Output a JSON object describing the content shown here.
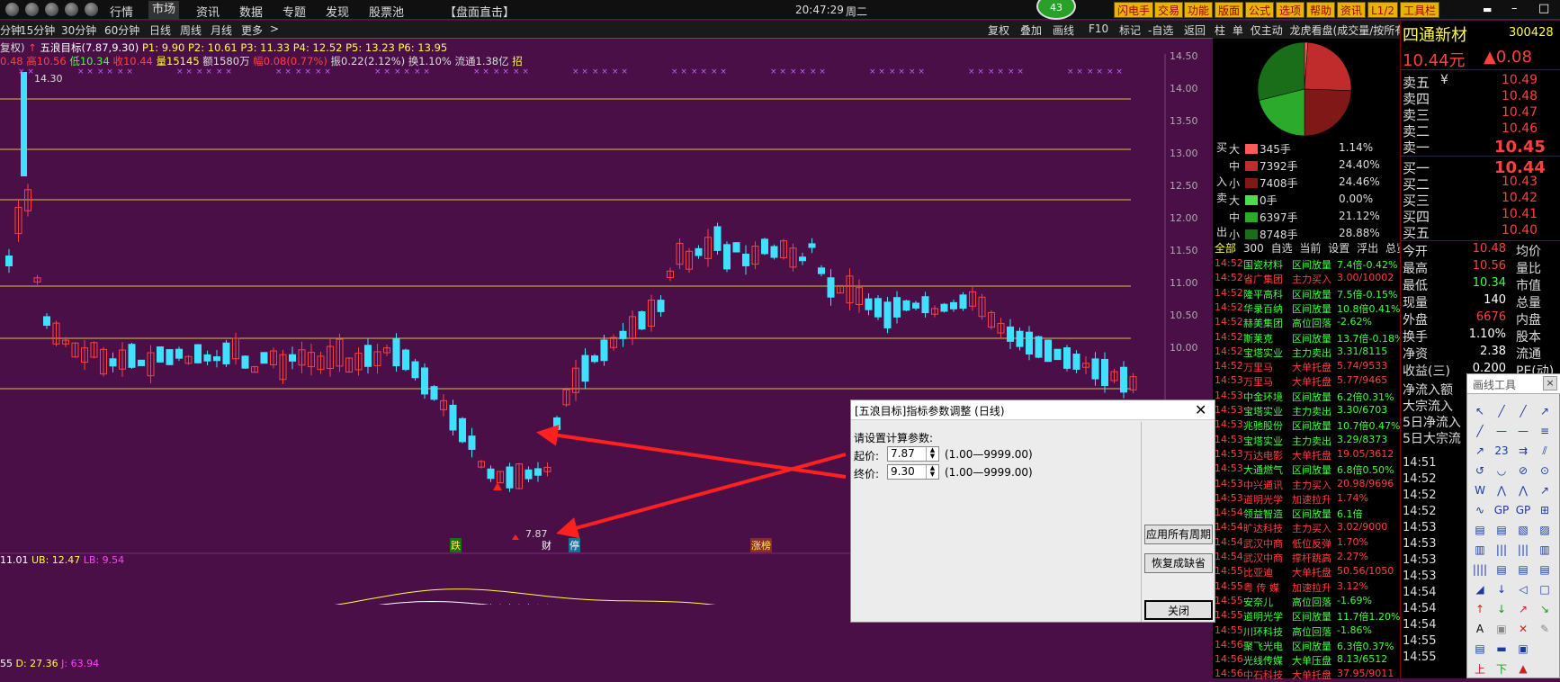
{
  "menubar": {
    "items": [
      "行情",
      "市场",
      "资讯",
      "数据",
      "专题",
      "发现",
      "股票池"
    ],
    "active": "市场",
    "center_title": "【盘面直击】",
    "clock": "20:47:29",
    "weekday": "周二",
    "badge": "43",
    "tools": [
      "闪电手",
      "交易",
      "功能",
      "版面",
      "公式",
      "选项",
      "帮助",
      "资讯",
      "L1/2",
      "工具栏"
    ]
  },
  "periodbar": {
    "periods": [
      "分钟",
      "15分钟",
      "30分钟",
      "60分钟",
      "日线",
      "周线",
      "月线",
      "更多"
    ],
    "more_arrow": ">",
    "right_items": [
      "复权",
      "叠加",
      "画线",
      "F10",
      "标记",
      "-自选",
      "返回"
    ]
  },
  "info": {
    "fuquan": "复权)",
    "indicator": "五浪目标(7.87,9.30)",
    "p1": "P1: 9.90",
    "p2": "P2: 10.61",
    "p3": "P3: 11.33",
    "p4": "P4: 12.52",
    "p5": "P5: 13.23",
    "p6": "P6: 13.95",
    "open": "0.48",
    "high": "高10.56",
    "low": "低10.34",
    "close": "收10.44",
    "vol": "量15145",
    "amt": "额1580万",
    "chg": "幅0.08(0.77%)",
    "amp": "振0.22(2.12%)",
    "turn": "换1.10%",
    "flow": "流通1.38亿",
    "tail": "招"
  },
  "chart": {
    "price_axis": [
      "14.50",
      "14.00",
      "13.50",
      "13.00",
      "12.50",
      "12.00",
      "11.50",
      "11.00",
      "10.50",
      "10.00"
    ],
    "high_label": "14.30",
    "low_label": "7.87",
    "markers": [
      "跌",
      "财",
      "停",
      "涨榜"
    ],
    "boll_line": "11.01",
    "ub": "UB: 12.47",
    "lb": "LB: 9.54",
    "kdj_k": "55",
    "kdj_d": "D: 27.36",
    "kdj_j": "J: 63.94"
  },
  "right": {
    "tabs": [
      "柱",
      "单",
      "仅主动",
      "龙虎看盘(成交量/按所有)"
    ],
    "flow_side_labels": [
      "买",
      "入",
      "卖",
      "出"
    ],
    "flows": [
      {
        "size": "大",
        "vol": "345手",
        "pct": "1.14%",
        "color": "#ff5a5a"
      },
      {
        "size": "中",
        "vol": "7392手",
        "pct": "24.40%",
        "color": "#c02c2c"
      },
      {
        "size": "小",
        "vol": "7408手",
        "pct": "24.46%",
        "color": "#801818"
      },
      {
        "size": "大",
        "vol": "0手",
        "pct": "0.00%",
        "color": "#4cdc4c"
      },
      {
        "size": "中",
        "vol": "6397手",
        "pct": "21.12%",
        "color": "#2caa2c"
      },
      {
        "size": "小",
        "vol": "8748手",
        "pct": "28.88%",
        "color": "#1a6e1a"
      }
    ],
    "filter_tabs": [
      "全部",
      "300",
      "自选",
      "当前",
      "设置",
      "浮出",
      "总览"
    ],
    "news": [
      {
        "t": "14:52",
        "name": "国瓷材料",
        "type": "区间放量",
        "val": "7.4倍-0.42%"
      },
      {
        "t": "14:52",
        "name": "省广集团",
        "type": "主力买入",
        "val": "3.00/10002"
      },
      {
        "t": "14:52",
        "name": "隆平高科",
        "type": "区间放量",
        "val": "7.5倍-0.15%"
      },
      {
        "t": "14:52",
        "name": "华录百纳",
        "type": "区间放量",
        "val": "10.8倍0.41%"
      },
      {
        "t": "14:52",
        "name": "赫美集团",
        "type": "高位回落",
        "val": "-2.62%"
      },
      {
        "t": "14:52",
        "name": "斯莱克",
        "type": "区间放量",
        "val": "13.7倍-0.18%"
      },
      {
        "t": "14:52",
        "name": "宝塔实业",
        "type": "主力卖出",
        "val": "3.31/8115"
      },
      {
        "t": "14:52",
        "name": "万里马",
        "type": "大单托盘",
        "val": "5.74/9533"
      },
      {
        "t": "14:53",
        "name": "万里马",
        "type": "大单托盘",
        "val": "5.77/9465"
      },
      {
        "t": "14:53",
        "name": "中金环境",
        "type": "区间放量",
        "val": "6.2倍0.31%"
      },
      {
        "t": "14:53",
        "name": "宝塔实业",
        "type": "主力卖出",
        "val": "3.30/6703"
      },
      {
        "t": "14:53",
        "name": "兆驰股份",
        "type": "区间放量",
        "val": "10.7倍0.47%"
      },
      {
        "t": "14:53",
        "name": "宝塔实业",
        "type": "主力卖出",
        "val": "3.29/8373"
      },
      {
        "t": "14:53",
        "name": "万达电影",
        "type": "大单托盘",
        "val": "19.05/3612"
      },
      {
        "t": "14:53",
        "name": "大通燃气",
        "type": "区间放量",
        "val": "6.8倍0.50%"
      },
      {
        "t": "14:53",
        "name": "中兴通讯",
        "type": "主力买入",
        "val": "20.98/9696"
      },
      {
        "t": "14:53",
        "name": "道明光学",
        "type": "加速拉升",
        "val": "1.74%"
      },
      {
        "t": "14:54",
        "name": "领益智造",
        "type": "区间放量",
        "val": "6.1倍"
      },
      {
        "t": "14:54",
        "name": "旷达科技",
        "type": "主力买入",
        "val": "3.02/9000"
      },
      {
        "t": "14:54",
        "name": "武汉中商",
        "type": "低位反弹",
        "val": "1.70%"
      },
      {
        "t": "14:54",
        "name": "武汉中商",
        "type": "撑杆跳高",
        "val": "2.27%"
      },
      {
        "t": "14:55",
        "name": "比亚迪",
        "type": "大单托盘",
        "val": "50.56/1050"
      },
      {
        "t": "14:55",
        "name": "粤 传 媒",
        "type": "加速拉升",
        "val": "3.12%"
      },
      {
        "t": "14:55",
        "name": "安奈儿",
        "type": "高位回落",
        "val": "-1.69%"
      },
      {
        "t": "14:55",
        "name": "道明光学",
        "type": "区间放量",
        "val": "11.7倍1.20%"
      },
      {
        "t": "14:55",
        "name": "川环科技",
        "type": "高位回落",
        "val": "-1.86%"
      },
      {
        "t": "14:56",
        "name": "聚飞光电",
        "type": "区间放量",
        "val": "6.3倍0.37%"
      },
      {
        "t": "14:56",
        "name": "光线传媒",
        "type": "大单压盘",
        "val": "8.13/6512"
      },
      {
        "t": "14:56",
        "name": "中石科技",
        "type": "大单托盘",
        "val": "37.95/9011"
      }
    ]
  },
  "quote": {
    "name": "四通新材",
    "code": "300428",
    "price": "10.44元",
    "change": "▲0.08",
    "asks": [
      {
        "label": "卖五",
        "price": "10.49"
      },
      {
        "label": "卖四",
        "price": "10.48"
      },
      {
        "label": "卖三",
        "price": "10.47"
      },
      {
        "label": "卖二",
        "price": "10.46"
      },
      {
        "label": "卖一",
        "price": "10.45"
      }
    ],
    "ask5_mark": "¥",
    "bids": [
      {
        "label": "买一",
        "price": "10.44"
      },
      {
        "label": "买二",
        "price": "10.43"
      },
      {
        "label": "买三",
        "price": "10.42"
      },
      {
        "label": "买四",
        "price": "10.41"
      },
      {
        "label": "买五",
        "price": "10.40"
      }
    ],
    "stats": [
      {
        "l": "今开",
        "v": "10.48",
        "l2": "均价"
      },
      {
        "l": "最高",
        "v": "10.56",
        "l2": "量比"
      },
      {
        "l": "最低",
        "v": "10.34",
        "l2": "市值"
      },
      {
        "l": "现量",
        "v": "140",
        "l2": "总量"
      },
      {
        "l": "外盘",
        "v": "6676",
        "l2": "内盘"
      },
      {
        "l": "换手",
        "v": "1.10%",
        "l2": "股本"
      },
      {
        "l": "净资",
        "v": "2.38",
        "l2": "流通"
      },
      {
        "l": "收益(三)",
        "v": "0.200",
        "l2": "PE(动)"
      }
    ],
    "flow_labels": [
      "净流入额",
      "大宗流入",
      "5日净流入",
      "5日大宗流"
    ],
    "ticks": [
      "14:51",
      "14:52",
      "14:52",
      "14:52",
      "14:53",
      "14:53",
      "14:53",
      "14:53",
      "14:54",
      "14:54",
      "14:54",
      "14:55",
      "14:55"
    ]
  },
  "dialog": {
    "title": "[五浪目标]指标参数调整 (日线)",
    "prompt": "请设置计算参数:",
    "start_label": "起价:",
    "start_value": "7.87",
    "start_range": "(1.00—9999.00)",
    "end_label": "终价:",
    "end_value": "9.30",
    "end_range": "(1.00—9999.00)",
    "btn_apply": "应用所有周期",
    "btn_reset": "恢复成缺省",
    "btn_close": "关闭"
  },
  "drawtools": {
    "title": "画线工具"
  }
}
